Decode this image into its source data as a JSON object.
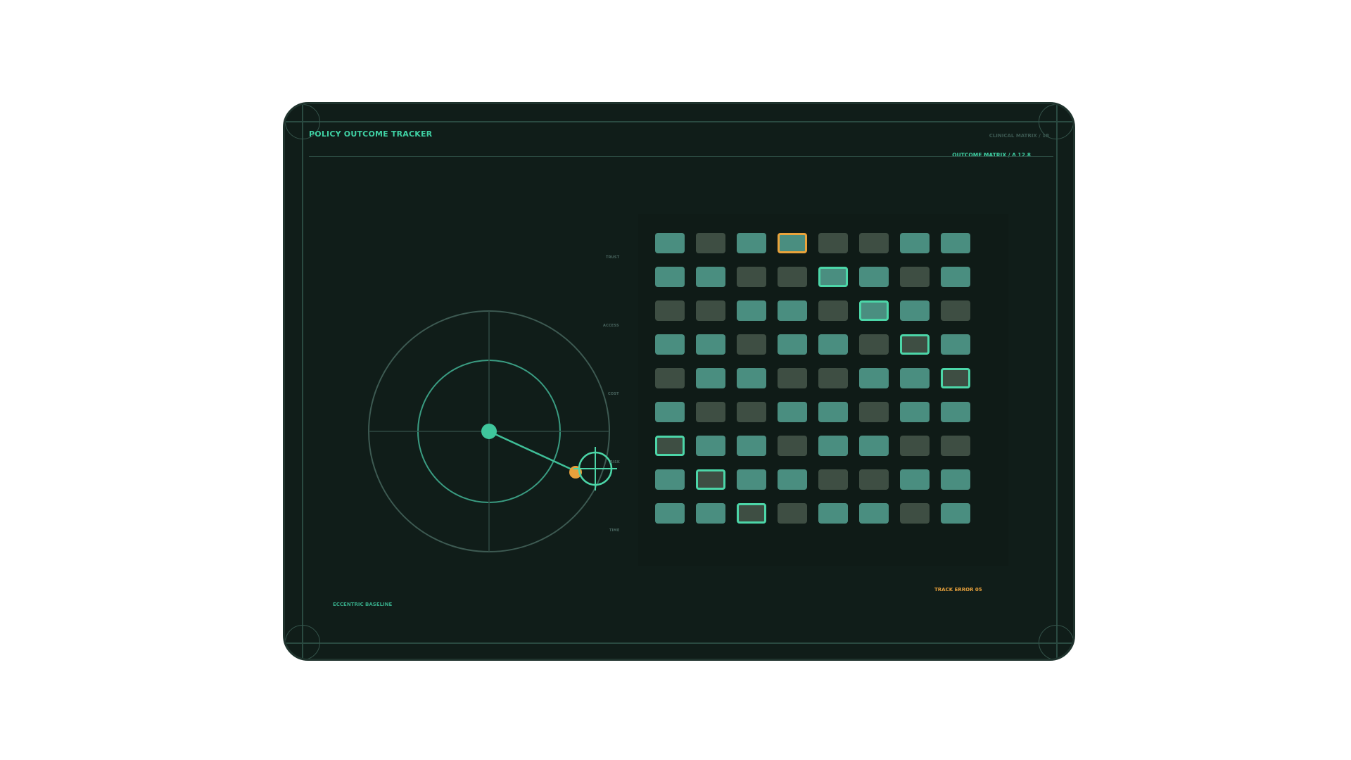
{
  "header": {
    "title": "POLICY OUTCOME TRACKER",
    "meta_dim": "CLINICAL MATRIX / 18",
    "meta_accent": "OUTCOME MATRIX / Δ 12.8"
  },
  "axis_labels": [
    "TRUST",
    "ACCESS",
    "COST",
    "RISK",
    "TIME"
  ],
  "footer": {
    "left_label": "ECCENTRIC BASELINE",
    "right_label": "TRACK ERROR 05"
  },
  "colors": {
    "panel": "#101d19",
    "accent": "#3fd0a3",
    "amber": "#e8a13c",
    "cell_teal": "#4a8e80",
    "cell_moss": "#3e4e43"
  },
  "matrix": {
    "rows": [
      [
        "teal",
        "moss",
        "teal",
        "teal",
        "moss",
        "moss",
        "teal",
        "teal"
      ],
      [
        "teal",
        "teal",
        "moss",
        "moss",
        "teal",
        "teal",
        "moss",
        "teal"
      ],
      [
        "moss",
        "moss",
        "teal",
        "teal",
        "moss",
        "teal",
        "teal",
        "moss"
      ],
      [
        "teal",
        "teal",
        "moss",
        "teal",
        "teal",
        "moss",
        "moss",
        "teal"
      ],
      [
        "moss",
        "teal",
        "teal",
        "moss",
        "moss",
        "teal",
        "teal",
        "moss"
      ],
      [
        "teal",
        "moss",
        "moss",
        "teal",
        "teal",
        "moss",
        "teal",
        "teal"
      ],
      [
        "moss",
        "teal",
        "teal",
        "moss",
        "teal",
        "teal",
        "moss",
        "moss"
      ],
      [
        "teal",
        "moss",
        "teal",
        "teal",
        "moss",
        "moss",
        "teal",
        "teal"
      ],
      [
        "teal",
        "teal",
        "moss",
        "moss",
        "teal",
        "teal",
        "moss",
        "teal"
      ]
    ],
    "highlights": [
      {
        "row": 0,
        "col": 3,
        "color": "amber"
      },
      {
        "row": 1,
        "col": 4,
        "color": "teal"
      },
      {
        "row": 2,
        "col": 5,
        "color": "teal"
      },
      {
        "row": 3,
        "col": 6,
        "color": "teal"
      },
      {
        "row": 4,
        "col": 7,
        "color": "teal"
      },
      {
        "row": 6,
        "col": 0,
        "color": "teal"
      },
      {
        "row": 7,
        "col": 1,
        "color": "teal"
      },
      {
        "row": 8,
        "col": 2,
        "color": "teal"
      }
    ]
  }
}
